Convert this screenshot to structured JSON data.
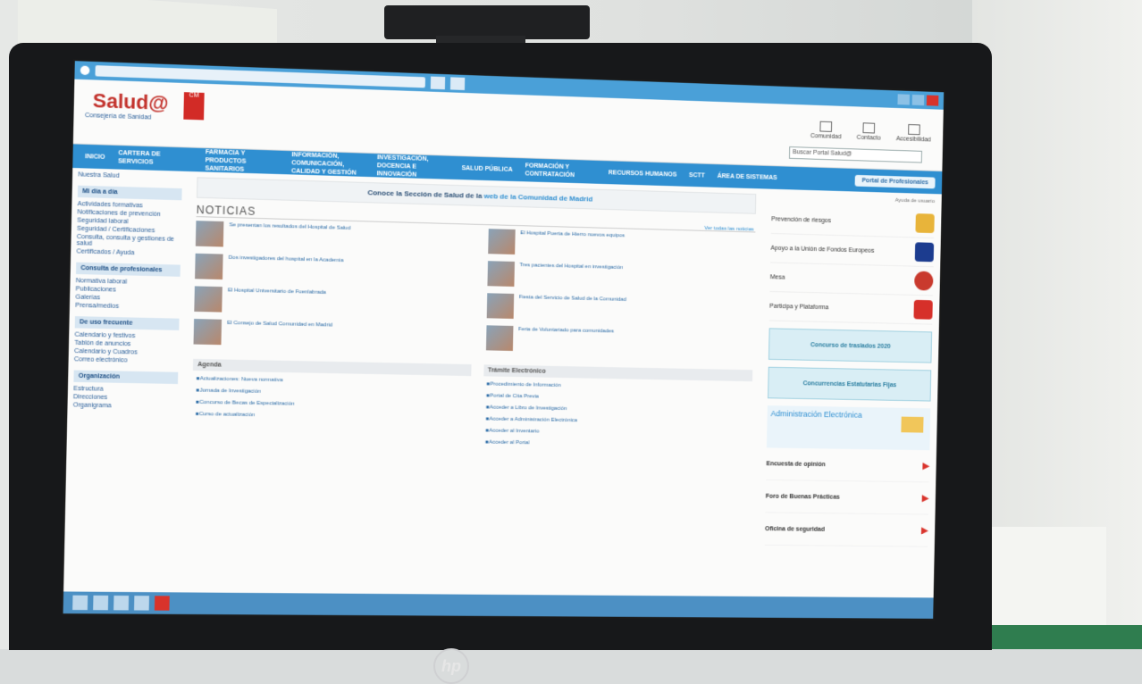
{
  "browser": {
    "tab_1": "",
    "tab_2": ""
  },
  "site": {
    "logo": "Salud@",
    "logo_sub": "Consejería de Sanidad",
    "region_badge": "CM",
    "tools": [
      "Comunidad",
      "Contacto",
      "Accesibilidad"
    ],
    "search_placeholder": "Buscar Portal Salud@"
  },
  "nav": {
    "items": [
      "INICIO",
      "CARTERA DE SERVICIOS",
      "FARMACIA Y PRODUCTOS SANITARIOS",
      "INFORMACIÓN, COMUNICACIÓN, CALIDAD Y GESTIÓN",
      "INVESTIGACIÓN, DOCENCIA E INNOVACIÓN",
      "SALUD PÚBLICA",
      "FORMACIÓN Y CONTRATACIÓN",
      "RECURSOS HUMANOS",
      "SCTT",
      "ÁREA DE SISTEMAS"
    ],
    "portal_button": "Portal de Profesionales"
  },
  "sidebar": {
    "breadcrumb": "Nuestra Salud",
    "sections": [
      {
        "title": "Mi día a día",
        "links": [
          "Actividades formativas",
          "Notificaciones de prevención",
          "Seguridad laboral",
          "Seguridad / Certificaciones",
          "Consulta, consulta y gestiones de salud",
          "Certificados / Ayuda"
        ]
      },
      {
        "title": "Consulta de profesionales",
        "links": [
          "Normativa laboral",
          "Publicaciones",
          "Galerías",
          "Prensa/medios"
        ]
      },
      {
        "title": "De uso frecuente",
        "links": [
          "Calendario y festivos",
          "Tablón de anuncios",
          "Calendario y Cuadros",
          "Correo electrónico"
        ]
      },
      {
        "title": "Organización",
        "links": [
          "Estructura",
          "Direcciones",
          "Organigrama"
        ]
      }
    ]
  },
  "main": {
    "banner_prefix": "Conoce la Sección de Salud de la",
    "banner_link": "web de la Comunidad de Madrid",
    "news_title": "NOTICIAS",
    "news_more": "Ver todas las noticias",
    "news": [
      "Se presentan los resultados del Hospital de Salud",
      "El Hospital Puerta de Hierro nuevos equipos",
      "Dos investigadores del hospital en la Academia",
      "Tres pacientes del Hospital en investigación",
      "El Hospital Universitario de Fuenlabrada",
      "Fiesta del Servicio de Salud de la Comunidad",
      "El Consejo de Salud Comunidad en Madrid",
      "Feria de Voluntariado para comunidades"
    ],
    "agenda_title": "Agenda",
    "agenda": [
      "Actualizaciones: Nueva normativa",
      "Jornada de Investigación",
      "Concurso de Becas de Especialización",
      "Curso de actualización"
    ],
    "tramites_title": "Trámite Electrónico",
    "tramites": [
      "Procedimiento de Información",
      "Portal de Cita Previa",
      "Acceder a Libro de Investigación",
      "Acceder a Administración Electrónica",
      "Acceder al Inventario",
      "Acceder al Portal"
    ]
  },
  "rightcol": {
    "help": "Ayuda de usuario",
    "items": [
      {
        "label": "Prevención de riesgos",
        "icon": "pencil-icon",
        "color": "#e8b43a"
      },
      {
        "label": "Apoyo a la Unión de Fondos Europeos",
        "icon": "eu-flag-icon",
        "color": "#1c3c8f"
      },
      {
        "label": "Mesa",
        "icon": "stamp-icon",
        "color": "#c93a2e"
      },
      {
        "label": "Participa y Plataforma",
        "icon": "star-icon",
        "color": "#d6302a"
      }
    ],
    "button_1": "Concurso de traslados 2020",
    "button_2": "Concurrencias Estatutarias Fijas",
    "admin_title": "Administración Electrónica",
    "arrow_items": [
      "Encuesta de opinión",
      "Foro de Buenas Prácticas",
      "Oficina de seguridad"
    ]
  },
  "device": {
    "brand": "hp"
  }
}
